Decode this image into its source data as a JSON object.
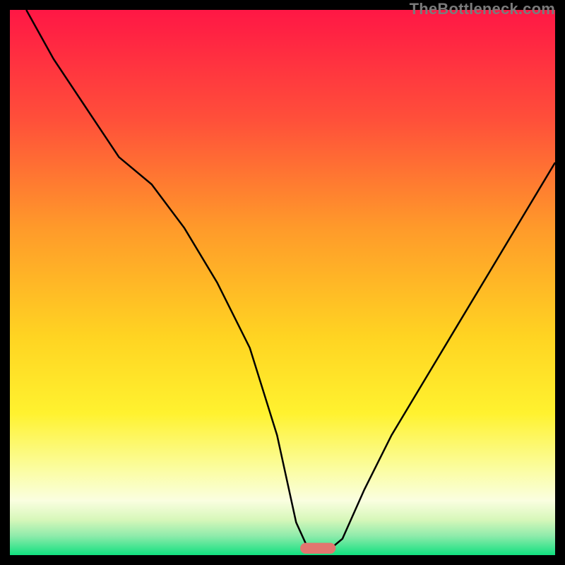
{
  "watermark": "TheBottleneck.com",
  "chart_data": {
    "type": "line",
    "title": "",
    "xlabel": "",
    "ylabel": "",
    "xlim": [
      0,
      100
    ],
    "ylim": [
      0,
      100
    ],
    "grid": false,
    "legend": false,
    "gradient_stops": [
      {
        "offset": 0,
        "color": "#ff1745"
      },
      {
        "offset": 0.2,
        "color": "#ff4f3a"
      },
      {
        "offset": 0.4,
        "color": "#ff9a2a"
      },
      {
        "offset": 0.6,
        "color": "#ffd422"
      },
      {
        "offset": 0.74,
        "color": "#fff22f"
      },
      {
        "offset": 0.84,
        "color": "#fbfd9e"
      },
      {
        "offset": 0.9,
        "color": "#fafee0"
      },
      {
        "offset": 0.935,
        "color": "#d7f7ba"
      },
      {
        "offset": 0.965,
        "color": "#8eebab"
      },
      {
        "offset": 1.0,
        "color": "#11e07f"
      }
    ],
    "series": [
      {
        "name": "bottleneck-curve",
        "x": [
          3,
          8,
          14,
          20,
          26,
          32,
          38,
          44,
          49,
          52.5,
          55,
          58,
          61,
          65,
          70,
          76,
          82,
          88,
          94,
          100
        ],
        "y": [
          100,
          91,
          82,
          73,
          68,
          60,
          50,
          38,
          22,
          6,
          0.5,
          0.5,
          3,
          12,
          22,
          32,
          42,
          52,
          62,
          72
        ]
      }
    ],
    "marker": {
      "name": "optimal-point",
      "x_center": 56.5,
      "width": 6.5,
      "height": 2.0,
      "color": "#e2766f"
    }
  }
}
